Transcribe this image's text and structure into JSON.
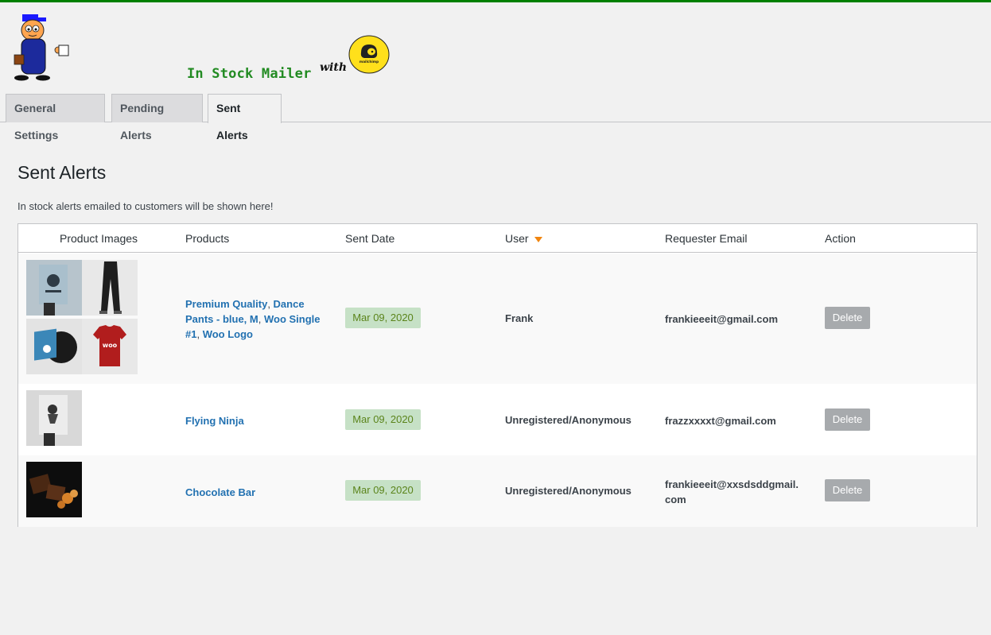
{
  "brand": {
    "title": "In Stock Mailer",
    "with_label": "with",
    "mailchimp_text": "mailchimp"
  },
  "colors": {
    "top_bar": "#008000",
    "brand_title": "#228b22",
    "link": "#2271b1",
    "sent_badge_bg": "#c6e1c6",
    "sent_badge_text": "#5b841b",
    "delete_button": "#a7aaad",
    "sort_arrow": "#f0850f"
  },
  "tabs": [
    {
      "label": "General Settings",
      "active": false
    },
    {
      "label": "Pending Alerts",
      "active": false
    },
    {
      "label": "Sent Alerts",
      "active": true
    }
  ],
  "page": {
    "title": "Sent Alerts",
    "description": "In stock alerts emailed to customers will be shown here!"
  },
  "table": {
    "columns": {
      "images": "Product Images",
      "products": "Products",
      "sent_date": "Sent Date",
      "user": "User",
      "email": "Requester Email",
      "action": "Action"
    },
    "sort_column": "user",
    "rows": [
      {
        "images": [
          "poster-icon",
          "dance-pants-icon",
          "vinyl-album-icon",
          "red-woo-tshirt-icon"
        ],
        "products": [
          "Premium Quality",
          "Dance Pants - blue, M",
          "Woo Single #1",
          "Woo Logo"
        ],
        "sent_date": "Mar 09, 2020",
        "user": "Frank",
        "email": "frankieeeit@gmail.com",
        "action": "Delete"
      },
      {
        "images": [
          "ninja-poster-icon"
        ],
        "products": [
          "Flying Ninja"
        ],
        "sent_date": "Mar 09, 2020",
        "user": "Unregistered/Anonymous",
        "email": "frazzxxxxt@gmail.com",
        "action": "Delete"
      },
      {
        "images": [
          "chocolate-bar-icon"
        ],
        "products": [
          "Chocolate Bar"
        ],
        "sent_date": "Mar 09, 2020",
        "user": "Unregistered/Anonymous",
        "email": "frankieeeit@xxsdsddgmail.com",
        "action": "Delete"
      }
    ]
  }
}
